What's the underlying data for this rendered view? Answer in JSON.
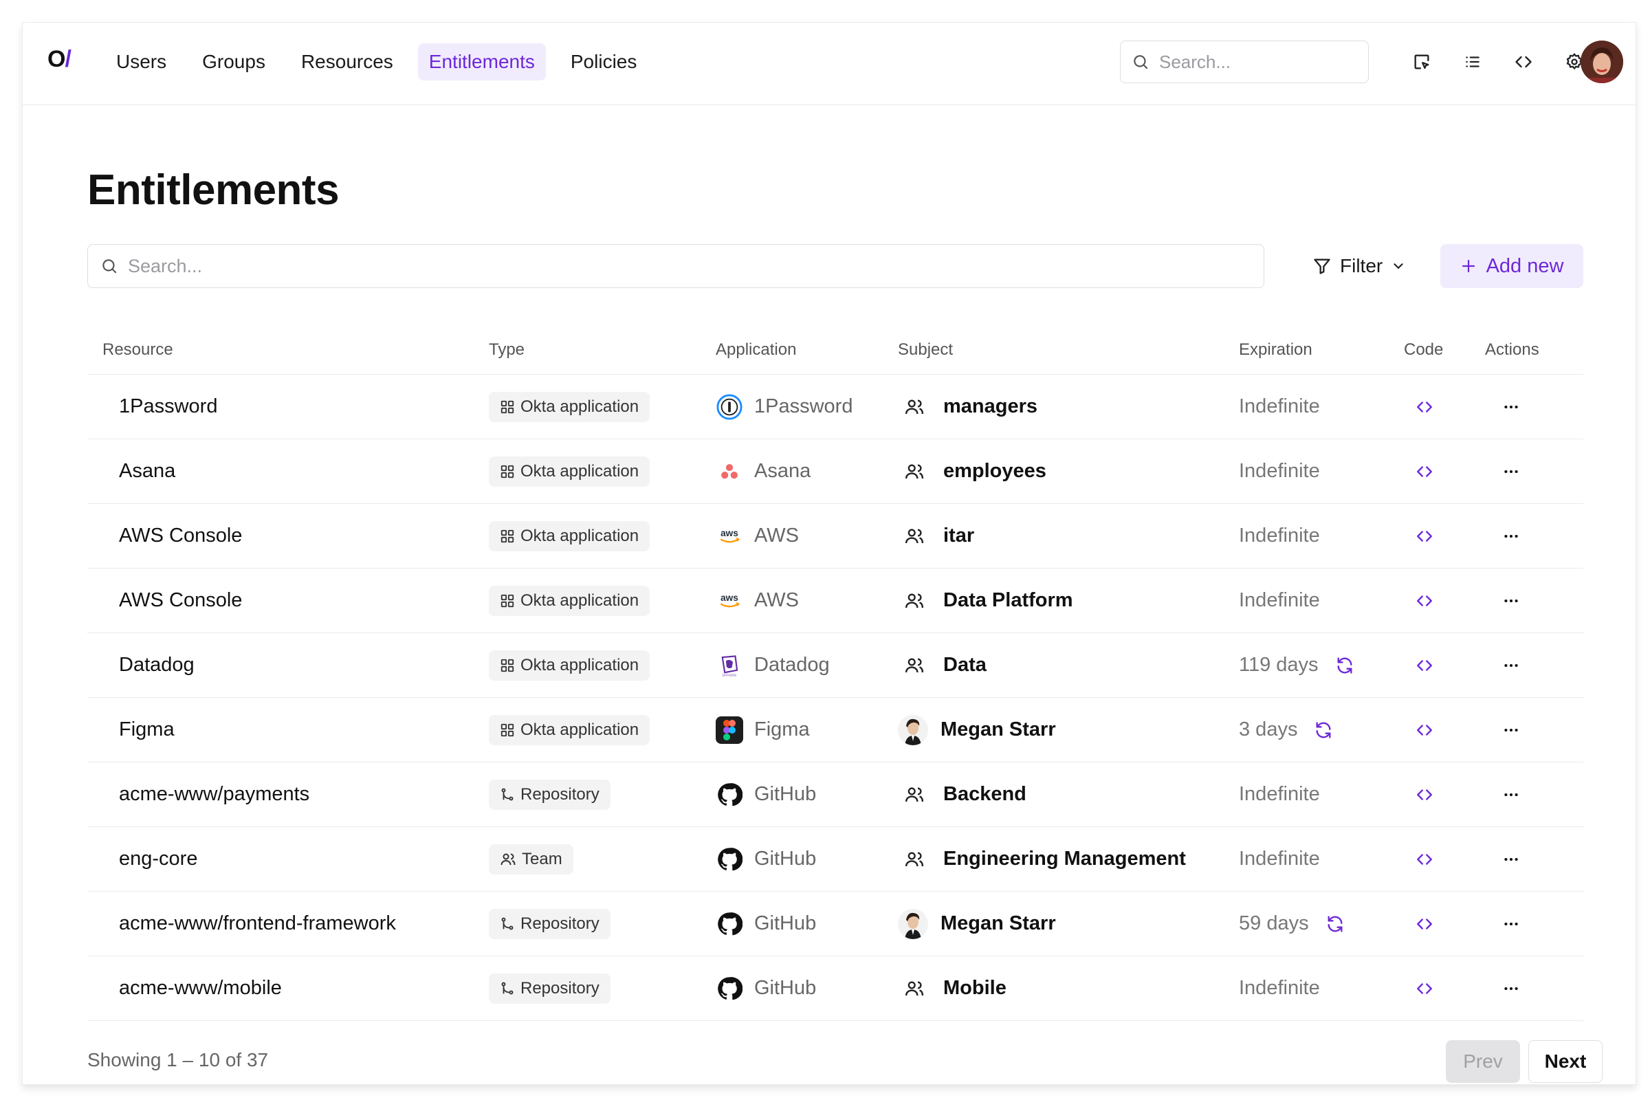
{
  "brand": {
    "logo_main": "O",
    "logo_slash": "/"
  },
  "nav": {
    "items": [
      {
        "label": "Users"
      },
      {
        "label": "Groups"
      },
      {
        "label": "Resources"
      },
      {
        "label": "Entitlements",
        "active": true
      },
      {
        "label": "Policies"
      }
    ]
  },
  "top_search": {
    "placeholder": "Search..."
  },
  "top_icons": [
    "inspect-icon",
    "list-icon",
    "code-icon",
    "gear-icon"
  ],
  "page": {
    "title": "Entitlements"
  },
  "search": {
    "placeholder": "Search..."
  },
  "toolbar": {
    "filter_label": "Filter",
    "add_label": "Add new"
  },
  "table": {
    "columns": {
      "resource": "Resource",
      "type": "Type",
      "application": "Application",
      "subject": "Subject",
      "expiration": "Expiration",
      "code": "Code",
      "actions": "Actions"
    },
    "rows": [
      {
        "resource": "1Password",
        "type": "Okta application",
        "type_icon": "grid-icon",
        "application": "1Password",
        "app_icon": "1password-icon",
        "subject": "managers",
        "subject_kind": "group",
        "expiration": "Indefinite",
        "renew": false
      },
      {
        "resource": "Asana",
        "type": "Okta application",
        "type_icon": "grid-icon",
        "application": "Asana",
        "app_icon": "asana-icon",
        "subject": "employees",
        "subject_kind": "group",
        "expiration": "Indefinite",
        "renew": false
      },
      {
        "resource": "AWS Console",
        "type": "Okta application",
        "type_icon": "grid-icon",
        "application": "AWS",
        "app_icon": "aws-icon",
        "subject": "itar",
        "subject_kind": "group",
        "expiration": "Indefinite",
        "renew": false
      },
      {
        "resource": "AWS Console",
        "type": "Okta application",
        "type_icon": "grid-icon",
        "application": "AWS",
        "app_icon": "aws-icon",
        "subject": "Data Platform",
        "subject_kind": "group",
        "expiration": "Indefinite",
        "renew": false
      },
      {
        "resource": "Datadog",
        "type": "Okta application",
        "type_icon": "grid-icon",
        "application": "Datadog",
        "app_icon": "datadog-icon",
        "subject": "Data",
        "subject_kind": "group",
        "expiration": "119 days",
        "renew": true
      },
      {
        "resource": "Figma",
        "type": "Okta application",
        "type_icon": "grid-icon",
        "application": "Figma",
        "app_icon": "figma-icon",
        "subject": "Megan Starr",
        "subject_kind": "user",
        "expiration": "3 days",
        "renew": true
      },
      {
        "resource": "acme-www/payments",
        "type": "Repository",
        "type_icon": "branch-icon",
        "application": "GitHub",
        "app_icon": "github-icon",
        "subject": "Backend",
        "subject_kind": "group",
        "expiration": "Indefinite",
        "renew": false
      },
      {
        "resource": "eng-core",
        "type": "Team",
        "type_icon": "team-icon",
        "application": "GitHub",
        "app_icon": "github-icon",
        "subject": "Engineering Management",
        "subject_kind": "group",
        "expiration": "Indefinite",
        "renew": false
      },
      {
        "resource": "acme-www/frontend-framework",
        "type": "Repository",
        "type_icon": "branch-icon",
        "application": "GitHub",
        "app_icon": "github-icon",
        "subject": "Megan Starr",
        "subject_kind": "user",
        "expiration": "59 days",
        "renew": true
      },
      {
        "resource": "acme-www/mobile",
        "type": "Repository",
        "type_icon": "branch-icon",
        "application": "GitHub",
        "app_icon": "github-icon",
        "subject": "Mobile",
        "subject_kind": "group",
        "expiration": "Indefinite",
        "renew": false
      }
    ]
  },
  "pagination": {
    "showing": "Showing 1 – 10 of 37",
    "prev_label": "Prev",
    "next_label": "Next"
  },
  "colors": {
    "accent": "#6d28d9",
    "accent_bg": "#f1ecfd",
    "border": "#e8e8ea",
    "muted_text": "#777777"
  }
}
